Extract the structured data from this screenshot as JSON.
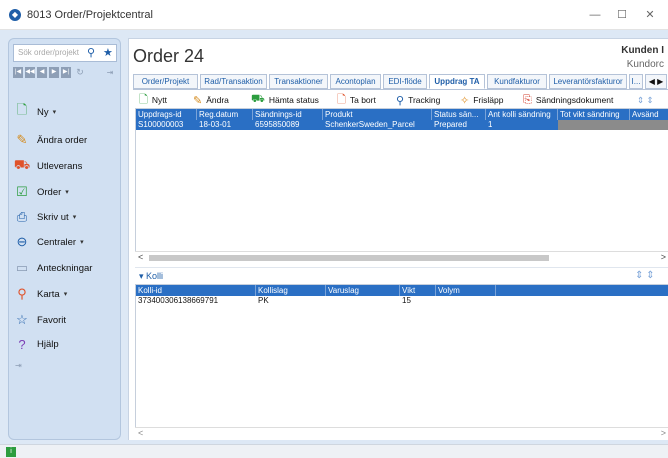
{
  "window": {
    "title": "8013 Order/Projektcentral",
    "app_icon": "app-logo-icon",
    "min": "—",
    "max": "☐",
    "close": "✕"
  },
  "sidebar": {
    "search_placeholder": "Sök order/projekt",
    "items": [
      {
        "label": "Ny",
        "icon": "new-document-icon",
        "dropdown": "▾"
      },
      {
        "label": "Ändra order",
        "icon": "edit-order-icon"
      },
      {
        "label": "Utleverans",
        "icon": "delivery-icon"
      },
      {
        "label": "Order",
        "icon": "order-icon",
        "dropdown": "▾"
      },
      {
        "label": "Skriv ut",
        "icon": "printer-icon",
        "dropdown": "▾"
      },
      {
        "label": "Centraler",
        "icon": "central-icon",
        "dropdown": "▾"
      },
      {
        "label": "Anteckningar",
        "icon": "notes-icon"
      },
      {
        "label": "Karta",
        "icon": "map-pin-icon",
        "dropdown": "▾"
      },
      {
        "label": "Favorit",
        "icon": "star-icon"
      },
      {
        "label": "Hjälp",
        "icon": "help-icon"
      }
    ]
  },
  "main": {
    "title": "Order 24",
    "customer": "Kunden I",
    "customer_sub": "Kundorc",
    "tabs": [
      "Order/Projekt",
      "Rad/Transaktion",
      "Transaktioner",
      "Acontoplan",
      "EDI-flöde",
      "Uppdrag TA",
      "Kundfakturor",
      "Leverantörsfakturor",
      "I..."
    ],
    "active_tab": "Uppdrag TA",
    "toolbar": [
      "Nytt",
      "Ändra",
      "Hämta status",
      "Ta bort",
      "Tracking",
      "Frisläpp",
      "Sändningsdokument"
    ],
    "grid1": {
      "columns": [
        "Uppdrags-id",
        "Reg.datum",
        "Sändnings-id",
        "Produkt",
        "Status sän...",
        "Ant kolli sändning",
        "Tot vikt sändning",
        "Avsänd"
      ],
      "rows": [
        [
          "S100000003",
          "18-03-01",
          "6595850089",
          "SchenkerSweden_Parcel",
          "Prepared",
          "1",
          "",
          ""
        ]
      ]
    },
    "kolli": {
      "title": "Kolli",
      "columns": [
        "Kolli-id",
        "Kollislag",
        "Varuslag",
        "Vikt",
        "Volym"
      ],
      "rows": [
        [
          "373400306138669791",
          "PK",
          "",
          "15",
          ""
        ]
      ]
    }
  }
}
